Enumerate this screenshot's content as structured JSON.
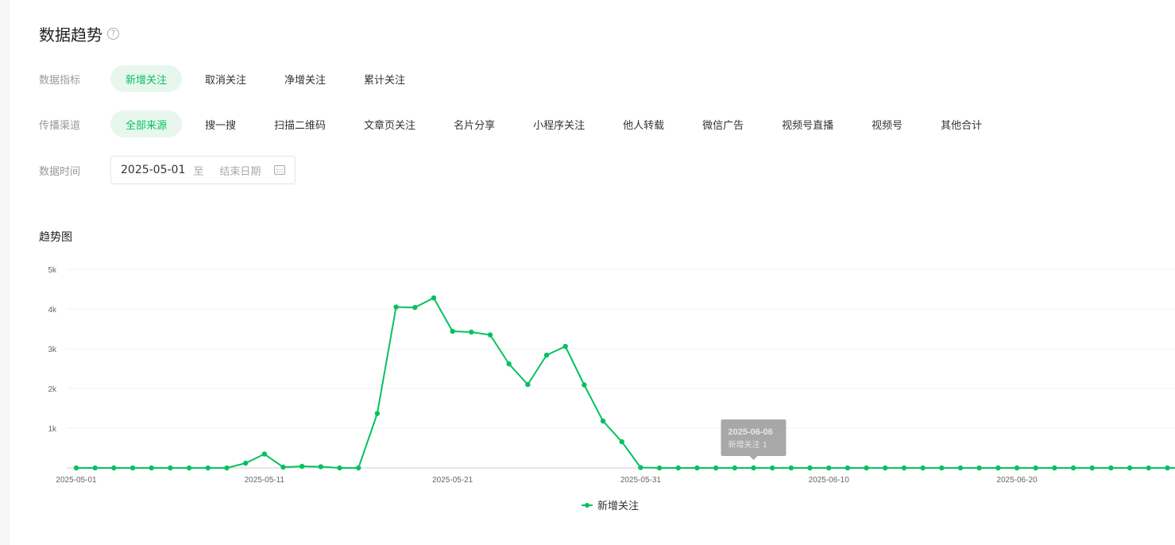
{
  "header": {
    "title": "数据趋势",
    "help_icon": "question-circle-icon"
  },
  "filters": {
    "metric": {
      "label": "数据指标",
      "options": [
        "新增关注",
        "取消关注",
        "净增关注",
        "累计关注"
      ],
      "selected": 0
    },
    "channel": {
      "label": "传播渠道",
      "options": [
        "全部来源",
        "搜一搜",
        "扫描二维码",
        "文章页关注",
        "名片分享",
        "小程序关注",
        "他人转载",
        "微信广告",
        "视频号直播",
        "视频号",
        "其他合计"
      ],
      "selected": 0
    },
    "date": {
      "label": "数据时间",
      "start": "2025-05-01",
      "separator": "至",
      "end_placeholder": "结束日期",
      "icon": "calendar-icon"
    }
  },
  "chart_section": {
    "title": "趋势图"
  },
  "chart_data": {
    "type": "line",
    "x_labels": [
      "2025-05-01",
      "2025-05-11",
      "2025-05-21",
      "2025-05-31",
      "2025-06-10",
      "2025-06-20"
    ],
    "x_start": "2025-05-01",
    "y_ticks": [
      "1k",
      "2k",
      "3k",
      "4k",
      "5k"
    ],
    "ylim": [
      0,
      5000
    ],
    "series": [
      {
        "name": "新增关注",
        "color": "#07c160",
        "values": [
          0,
          0,
          0,
          0,
          0,
          0,
          0,
          0,
          0,
          120,
          350,
          20,
          40,
          30,
          0,
          0,
          1370,
          4050,
          4040,
          4280,
          3440,
          3420,
          3350,
          2620,
          2100,
          2840,
          3060,
          2090,
          1180,
          660,
          10,
          0,
          0,
          0,
          0,
          0,
          1,
          0,
          0,
          0,
          0,
          0,
          0,
          0,
          0,
          0,
          0,
          0,
          0,
          0,
          0,
          0,
          0,
          0,
          0,
          0,
          0,
          0,
          0,
          0
        ]
      }
    ],
    "tooltip": {
      "date": "2025-06-06",
      "text": "新增关注 1"
    }
  }
}
